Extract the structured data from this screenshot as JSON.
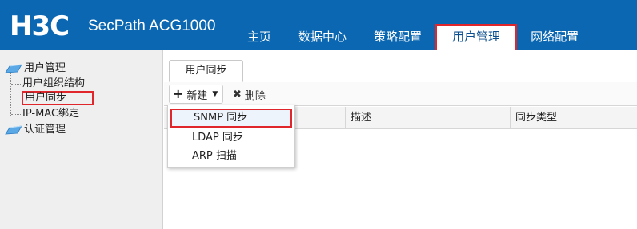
{
  "header": {
    "logo": "H3C",
    "product": "SecPath ACG1000",
    "nav": [
      {
        "label": "主页"
      },
      {
        "label": "数据中心"
      },
      {
        "label": "策略配置"
      },
      {
        "label": "用户管理"
      },
      {
        "label": "网络配置"
      }
    ],
    "active_nav": "用户管理"
  },
  "sidebar": {
    "groups": [
      {
        "label": "用户管理",
        "children": [
          "用户组织结构",
          "用户同步",
          "IP-MAC绑定"
        ]
      },
      {
        "label": "认证管理",
        "children": []
      }
    ],
    "selected": "用户同步"
  },
  "main": {
    "tab": "用户同步",
    "toolbar": {
      "new_label": "新建",
      "delete_label": "删除"
    },
    "columns": [
      "",
      "描述",
      "同步类型"
    ]
  },
  "dropdown": {
    "items": [
      "SNMP 同步",
      "LDAP 同步",
      "ARP 扫描"
    ],
    "highlighted": "SNMP 同步"
  },
  "colors": {
    "header_bg": "#0b67b1",
    "highlight_border": "#e0262b",
    "sidebar_bg": "#efefef"
  }
}
